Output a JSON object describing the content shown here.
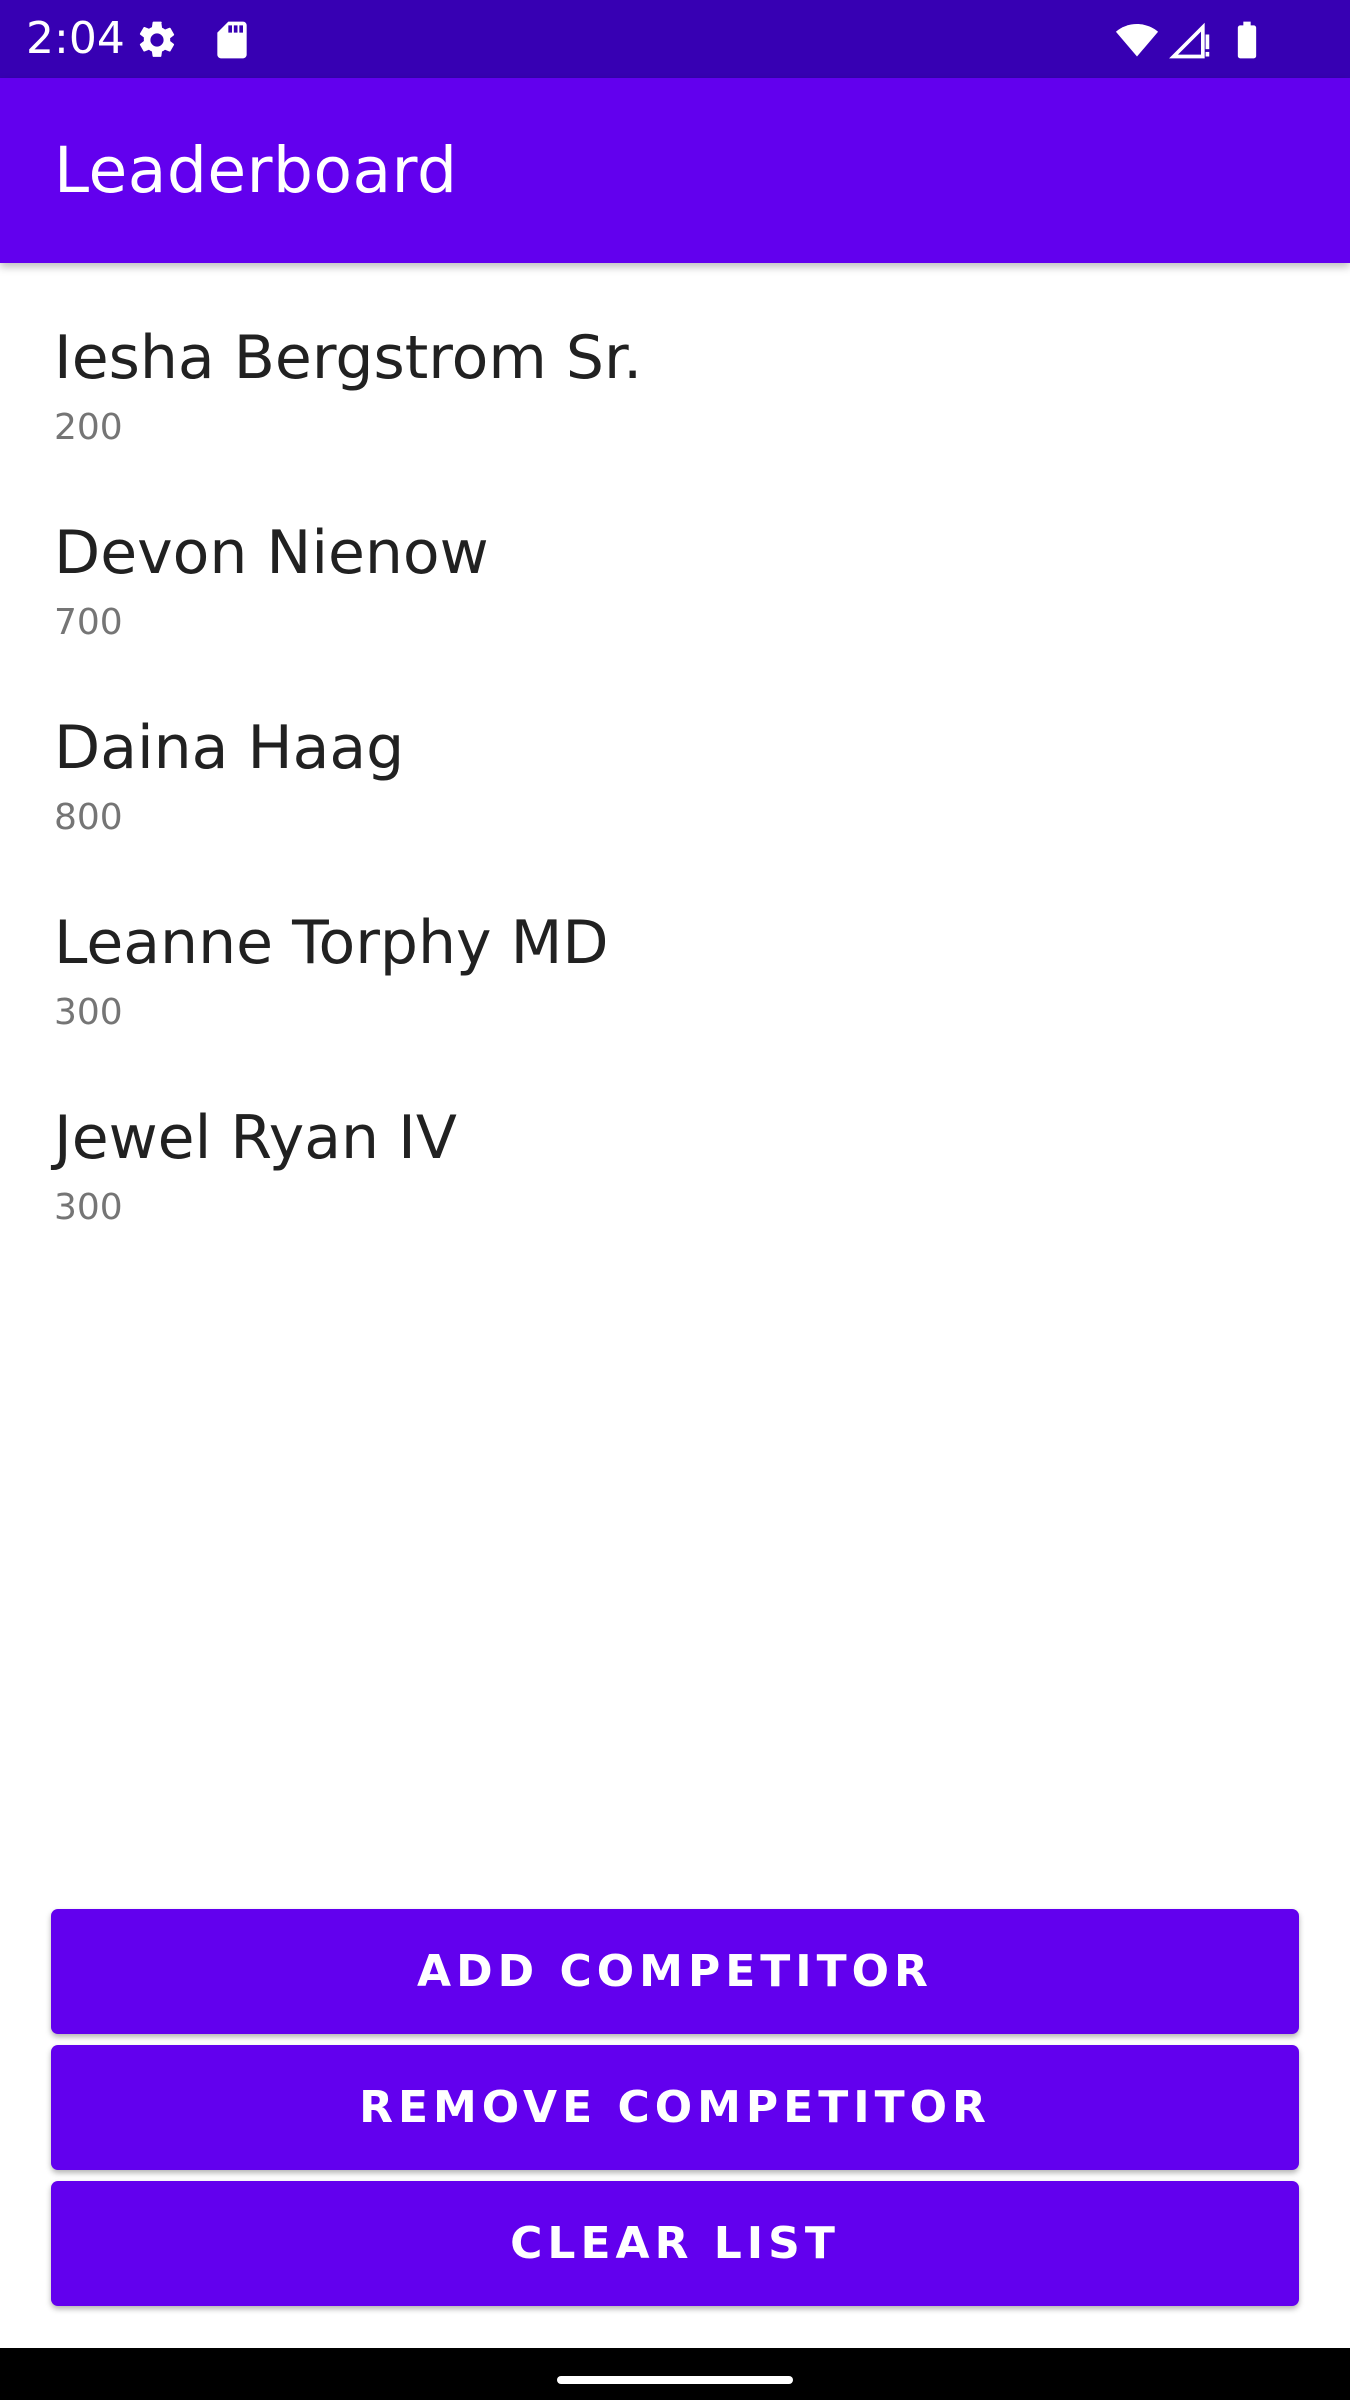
{
  "status_bar": {
    "time": "2:04",
    "icons": [
      "gear-icon",
      "sd-card-icon",
      "wifi-icon",
      "signal-icon",
      "battery-icon"
    ]
  },
  "app_bar": {
    "title": "Leaderboard"
  },
  "competitors": [
    {
      "name": "Iesha Bergstrom Sr.",
      "score": "200"
    },
    {
      "name": "Devon Nienow",
      "score": "700"
    },
    {
      "name": "Daina Haag",
      "score": "800"
    },
    {
      "name": "Leanne Torphy MD",
      "score": "300"
    },
    {
      "name": "Jewel Ryan IV",
      "score": "300"
    }
  ],
  "buttons": {
    "add_label": "ADD COMPETITOR",
    "remove_label": "REMOVE COMPETITOR",
    "clear_label": "CLEAR LIST"
  },
  "colors": {
    "status_bar": "#3700b3",
    "primary": "#6200ee",
    "name_text": "#212121",
    "score_text": "#757575"
  }
}
